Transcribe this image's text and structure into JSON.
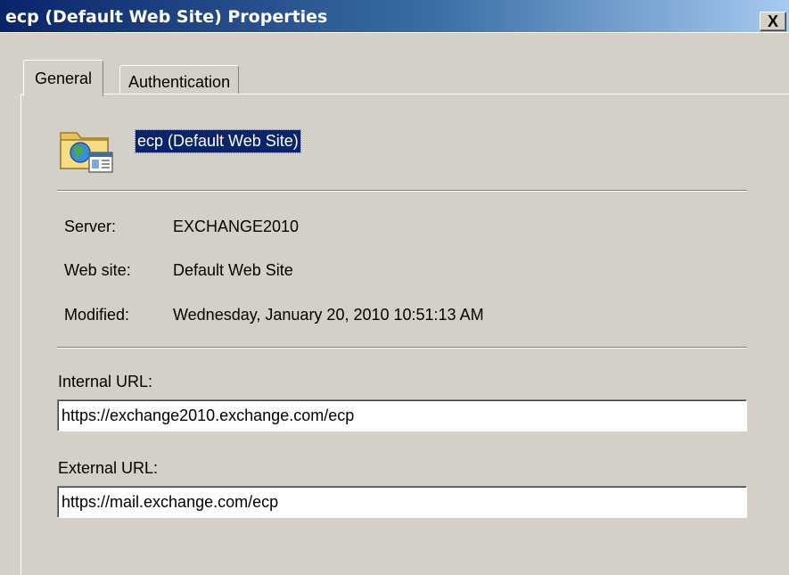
{
  "window": {
    "title": "ecp (Default Web Site) Properties",
    "close_label": "X"
  },
  "tabs": [
    {
      "label": "General",
      "selected": true
    },
    {
      "label": "Authentication",
      "selected": false
    }
  ],
  "general": {
    "name": "ecp (Default Web Site)",
    "icon": "web-folder-icon",
    "info": [
      {
        "label": "Server:",
        "value": "EXCHANGE2010"
      },
      {
        "label": "Web site:",
        "value": "Default Web Site"
      },
      {
        "label": "Modified:",
        "value": "Wednesday, January 20, 2010 10:51:13 AM"
      }
    ],
    "internal_url": {
      "label": "Internal URL:",
      "value": "https://exchange2010.exchange.com/ecp"
    },
    "external_url": {
      "label": "External URL:",
      "value": "https://mail.exchange.com/ecp"
    }
  },
  "colors": {
    "title_gradient_start": "#0a246a",
    "title_gradient_end": "#a6caf0",
    "dialog_bg": "#d4d0c8",
    "selection_bg": "#0a246a"
  }
}
